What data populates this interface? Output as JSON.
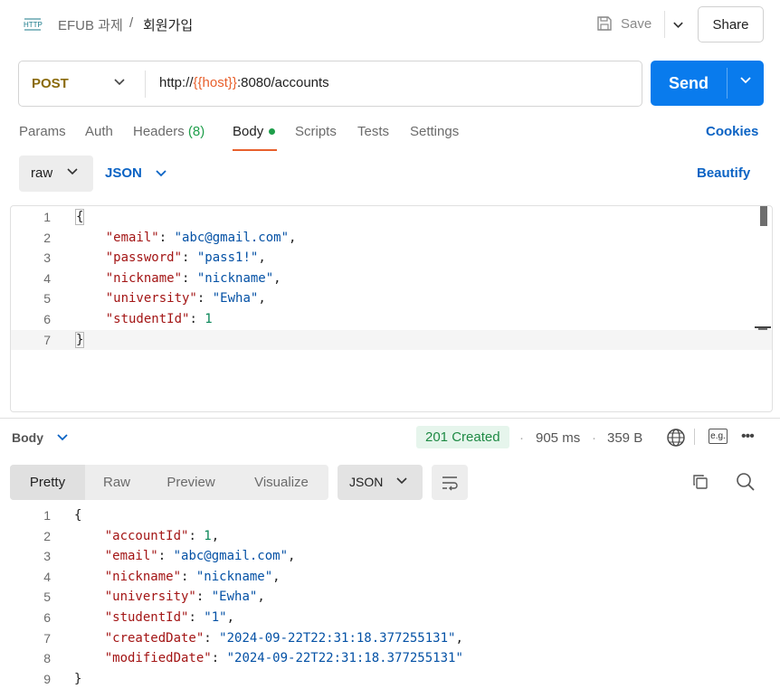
{
  "header": {
    "collection": "EFUB 과제",
    "separator": "/",
    "request_name": "회원가입",
    "save_label": "Save",
    "share_label": "Share"
  },
  "request": {
    "method": "POST",
    "url_prefix": "http://",
    "url_variable": "{{host}}",
    "url_suffix": ":8080/accounts",
    "send_label": "Send"
  },
  "request_tabs": {
    "params": "Params",
    "auth": "Auth",
    "headers": "Headers",
    "headers_count": "(8)",
    "body": "Body",
    "scripts": "Scripts",
    "tests": "Tests",
    "settings": "Settings",
    "cookies": "Cookies"
  },
  "body_mode": {
    "mode": "raw",
    "language": "JSON",
    "beautify": "Beautify"
  },
  "request_body": [
    {
      "n": "1",
      "text": "{"
    },
    {
      "n": "2",
      "key": "\"email\"",
      "value": "\"abc@gmail.com\"",
      "vtype": "s",
      "comma": ","
    },
    {
      "n": "3",
      "key": "\"password\"",
      "value": "\"pass1!\"",
      "vtype": "s",
      "comma": ","
    },
    {
      "n": "4",
      "key": "\"nickname\"",
      "value": "\"nickname\"",
      "vtype": "s",
      "comma": ","
    },
    {
      "n": "5",
      "key": "\"university\"",
      "value": "\"Ewha\"",
      "vtype": "s",
      "comma": ","
    },
    {
      "n": "6",
      "key": "\"studentId\"",
      "value": "1",
      "vtype": "n",
      "comma": ""
    },
    {
      "n": "7",
      "text": "}"
    }
  ],
  "response": {
    "body_label": "Body",
    "status": "201 Created",
    "time": "905 ms",
    "size": "359 B",
    "eg_label": "e.g.",
    "views": [
      "Pretty",
      "Raw",
      "Preview",
      "Visualize"
    ],
    "format": "JSON"
  },
  "response_body": [
    {
      "n": "1",
      "text": "{"
    },
    {
      "n": "2",
      "key": "\"accountId\"",
      "value": "1",
      "vtype": "n",
      "comma": ","
    },
    {
      "n": "3",
      "key": "\"email\"",
      "value": "\"abc@gmail.com\"",
      "vtype": "s",
      "comma": ","
    },
    {
      "n": "4",
      "key": "\"nickname\"",
      "value": "\"nickname\"",
      "vtype": "s",
      "comma": ","
    },
    {
      "n": "5",
      "key": "\"university\"",
      "value": "\"Ewha\"",
      "vtype": "s",
      "comma": ","
    },
    {
      "n": "6",
      "key": "\"studentId\"",
      "value": "\"1\"",
      "vtype": "s",
      "comma": ","
    },
    {
      "n": "7",
      "key": "\"createdDate\"",
      "value": "\"2024-09-22T22:31:18.377255131\"",
      "vtype": "s",
      "comma": ","
    },
    {
      "n": "8",
      "key": "\"modifiedDate\"",
      "value": "\"2024-09-22T22:31:18.377255131\"",
      "vtype": "s",
      "comma": ""
    },
    {
      "n": "9",
      "text": "}"
    }
  ],
  "colors": {
    "accent_blue": "#097bed",
    "link_blue": "#0b63c4",
    "method_post": "#8a6a0a",
    "variable_orange": "#e8602c",
    "status_green": "#1e8a44"
  }
}
